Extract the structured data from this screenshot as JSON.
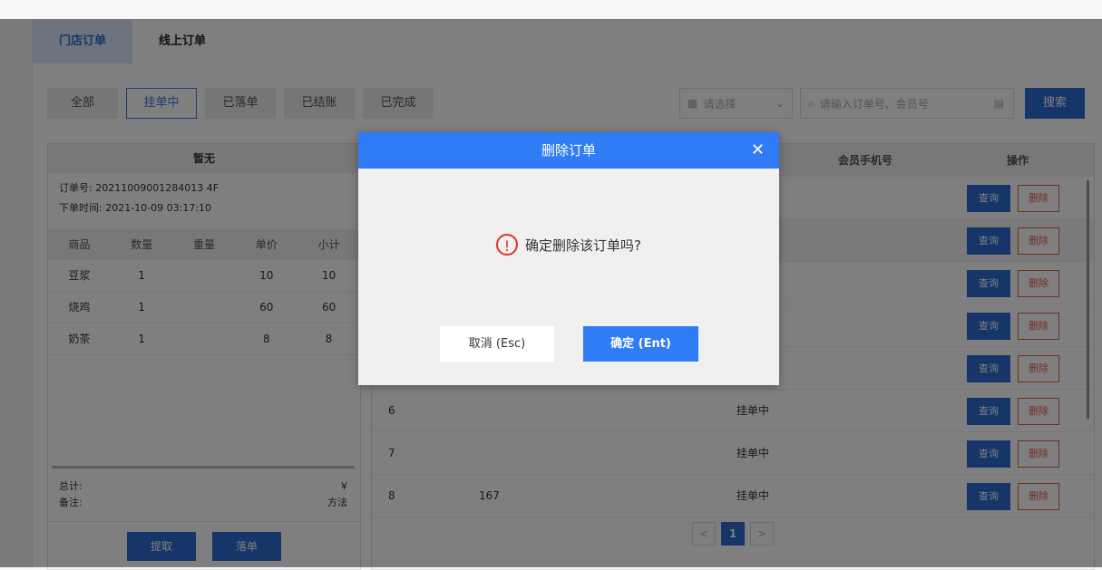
{
  "tabs": [
    "门店订单",
    "线上订单"
  ],
  "filters": [
    "全部",
    "挂单中",
    "已落单",
    "已结账",
    "已完成"
  ],
  "filter_active": 1,
  "select_placeholder": "请选择",
  "search_placeholder": "请输入订单号、会员号",
  "search_button": "搜索",
  "left": {
    "title": "暂无",
    "order_no_label": "订单号:",
    "order_no": "20211009001284013 4F",
    "time_label": "下单时间:",
    "time": "2021-10-09 03:17:10",
    "headers": [
      "商品",
      "数量",
      "重量",
      "单价",
      "小计"
    ],
    "items": [
      [
        "豆浆",
        "1",
        "",
        "10",
        "10"
      ],
      [
        "烧鸡",
        "1",
        "",
        "60",
        "60"
      ],
      [
        "奶茶",
        "1",
        "",
        "8",
        "8"
      ]
    ],
    "total_label": "总计:",
    "total_value": "¥",
    "note_label": "备注:",
    "note_value": "方法",
    "btn_fetch": "提取",
    "btn_place": "落单"
  },
  "table": {
    "headers": {
      "phone": "会员手机号",
      "ops": "操作"
    },
    "rows": [
      {
        "no": "",
        "member": "",
        "status": ""
      },
      {
        "no": "",
        "member": "",
        "status": ""
      },
      {
        "no": "",
        "member": "",
        "status": ""
      },
      {
        "no": "",
        "member": "",
        "status": ""
      },
      {
        "no": "",
        "member": "",
        "status": ""
      },
      {
        "no": "6",
        "member": "",
        "status": "挂单中"
      },
      {
        "no": "7",
        "member": "",
        "status": "挂单中"
      },
      {
        "no": "8",
        "member": "167",
        "status": "挂单中"
      }
    ],
    "query_label": "查询",
    "delete_label": "删除"
  },
  "pager": {
    "prev": "<",
    "current": "1",
    "next": ">"
  },
  "dialog": {
    "title": "删除订单",
    "message": "确定删除该订单吗?",
    "cancel": "取消 (Esc)",
    "ok": "确定 (Ent)"
  }
}
